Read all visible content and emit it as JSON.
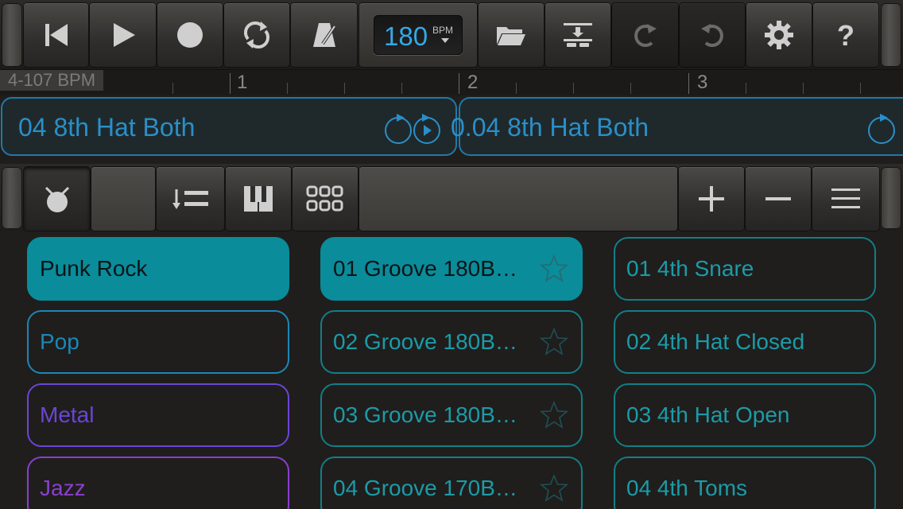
{
  "transport": {
    "bpm_value": "180",
    "bpm_unit": "BPM",
    "icons": [
      "rewind-icon",
      "play-icon",
      "record-icon",
      "loop-icon",
      "metronome-icon",
      "folder-icon",
      "tracks-icon",
      "redo-icon",
      "undo-icon",
      "gear-icon",
      "help-icon"
    ]
  },
  "ruler": {
    "tempo_label": "4-107 BPM",
    "bars": [
      "1",
      "2",
      "3"
    ]
  },
  "regions": [
    {
      "label": "04 8th Hat Both"
    },
    {
      "label": "0.04 8th Hat Both"
    }
  ],
  "colors": {
    "accent": "#0a8c9a",
    "region": "#2079a8",
    "pop": "#1b87b8",
    "metal": "#6b45d6",
    "jazz": "#8a3fcf",
    "teal_text": "#1b9ba8",
    "bpm_lcd": "#35a8e8"
  },
  "browser": {
    "genres": [
      {
        "label": "Punk Rock",
        "selected": true
      },
      {
        "label": "Pop",
        "selected": false
      },
      {
        "label": "Metal",
        "selected": false
      },
      {
        "label": "Jazz",
        "selected": false
      }
    ],
    "grooves": [
      {
        "label": "01 Groove 180B…",
        "selected": true
      },
      {
        "label": "02 Groove 180B…",
        "selected": false
      },
      {
        "label": "03 Groove 180B…",
        "selected": false
      },
      {
        "label": "04 Groove 170B…",
        "selected": false
      }
    ],
    "patterns": [
      {
        "label": "01 4th Snare"
      },
      {
        "label": "02 4th Hat Closed"
      },
      {
        "label": "03 4th Hat Open"
      },
      {
        "label": "04 4th Toms"
      }
    ]
  }
}
